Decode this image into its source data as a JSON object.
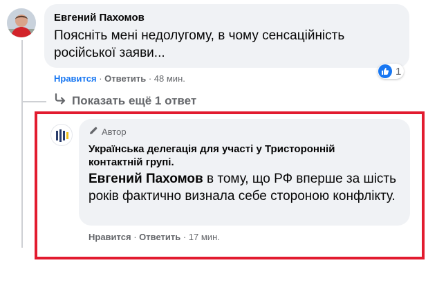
{
  "comment": {
    "author": "Евгений Пахомов",
    "text": "Поясніть мені недолугому, в чому сенсаційність російської заяви...",
    "actions": {
      "like": "Нравится",
      "reply": "Ответить",
      "time": "48 мин.",
      "separator": "·"
    },
    "reactions": {
      "icon": "thumbs-up-icon",
      "count": "1",
      "color": "#1877f2"
    }
  },
  "show_more": {
    "label": "Показать ещё 1 ответ",
    "icon": "reply-arrow-icon"
  },
  "reply": {
    "badge": "Автор",
    "badge_icon": "pencil-icon",
    "author": "Українська делегація для участі у Тристоронній контактній групі.",
    "mention": "Евгений Пахомов",
    "text": " в тому, що РФ вперше за шість років фактично визнала себе стороною конфлікту.",
    "actions": {
      "like": "Нравится",
      "reply": "Ответить",
      "time": "17 мин.",
      "separator": "·"
    }
  },
  "highlight_color": "#e21b2f"
}
